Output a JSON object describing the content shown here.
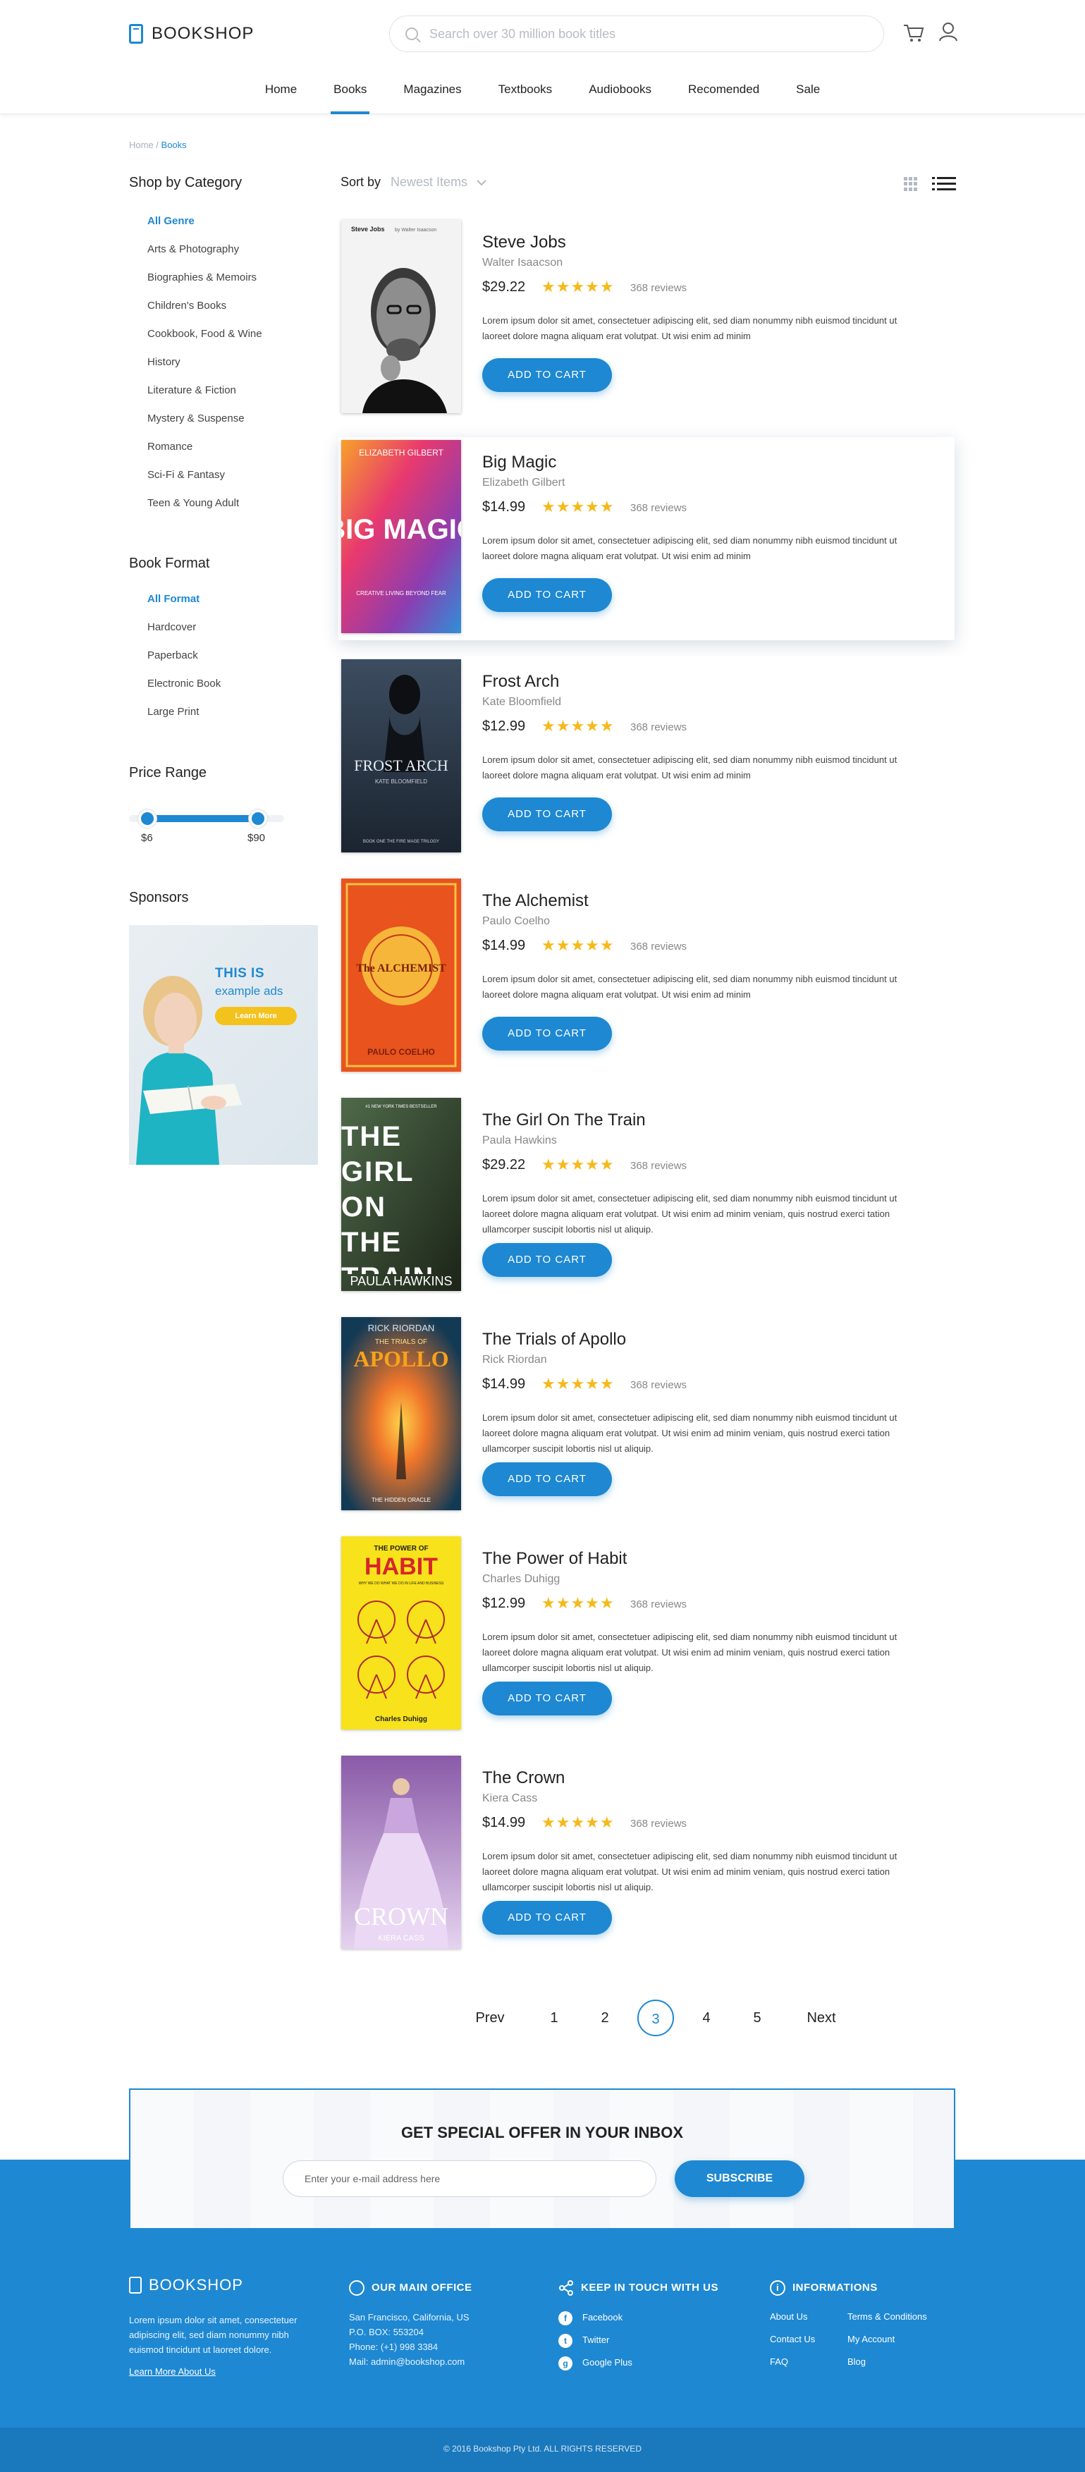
{
  "header": {
    "logo": "BOOKSHOP",
    "search_placeholder": "Search over 30 million book titles",
    "nav": [
      {
        "label": "Home",
        "active": false
      },
      {
        "label": "Books",
        "active": true
      },
      {
        "label": "Magazines",
        "active": false
      },
      {
        "label": "Textbooks",
        "active": false
      },
      {
        "label": "Audiobooks",
        "active": false
      },
      {
        "label": "Recomended",
        "active": false
      },
      {
        "label": "Sale",
        "active": false
      }
    ]
  },
  "breadcrumb": {
    "home": "Home",
    "sep": " / ",
    "current": "Books"
  },
  "sidebar": {
    "category_title": "Shop by Category",
    "categories": [
      "All Genre",
      "Arts & Photography",
      "Biographies & Memoirs",
      "Children's Books",
      "Cookbook, Food & Wine",
      "History",
      "Literature & Fiction",
      "Mystery & Suspense",
      "Romance",
      "Sci-Fi & Fantasy",
      "Teen & Young Adult"
    ],
    "format_title": "Book Format",
    "formats": [
      "All Format",
      "Hardcover",
      "Paperback",
      "Electronic Book",
      "Large Print"
    ],
    "price_title": "Price Range",
    "price_min": "$6",
    "price_max": "$90",
    "price_low_fraction": 0.12,
    "price_high_fraction": 0.83,
    "sponsors_title": "Sponsors",
    "ad": {
      "line1": "THIS IS",
      "line2": "example ads",
      "button": "Learn More"
    }
  },
  "sort": {
    "label": "Sort by",
    "value": "Newest Items"
  },
  "books": [
    {
      "title": "Steve Jobs",
      "author": "Walter Isaacson",
      "price": "$29.22",
      "reviews": "368 reviews",
      "rating": 5,
      "desc": "Lorem ipsum dolor sit amet, consectetuer adipiscing elit, sed diam nonummy nibh euismod tincidunt ut laoreet dolore magna aliquam erat volutpat. Ut wisi enim ad minim",
      "button": "ADD TO CART",
      "highlighted": false,
      "cover_top": "Steve Jobs",
      "cover_by": "by Walter Isaacson",
      "cover_bg": "#f3f3f3"
    },
    {
      "title": "Big Magic",
      "author": "Elizabeth Gilbert",
      "price": "$14.99",
      "reviews": "368 reviews",
      "rating": 5,
      "desc": "Lorem ipsum dolor sit amet, consectetuer adipiscing elit, sed diam nonummy nibh euismod tincidunt ut laoreet dolore magna aliquam erat volutpat. Ut wisi enim ad minim",
      "button": "ADD TO CART",
      "highlighted": true,
      "cover_top": "ELIZABETH GILBERT",
      "cover_big": "BIG MAGIC",
      "cover_sub": "CREATIVE LIVING BEYOND FEAR",
      "cover_bg": "#e03a7a"
    },
    {
      "title": "Frost Arch",
      "author": "Kate Bloomfield",
      "price": "$12.99",
      "reviews": "368 reviews",
      "rating": 5,
      "desc": "Lorem ipsum dolor sit amet, consectetuer adipiscing elit, sed diam nonummy nibh euismod tincidunt ut laoreet dolore magna aliquam erat volutpat. Ut wisi enim ad minim",
      "button": "ADD TO CART",
      "highlighted": false,
      "cover_big": "FROST ARCH",
      "cover_by": "KATE BLOOMFIELD",
      "cover_sub": "BOOK ONE THE FIRE MAGE TRILOGY",
      "cover_bg": "#2c3a4a"
    },
    {
      "title": "The Alchemist",
      "author": "Paulo Coelho",
      "price": "$14.99",
      "reviews": "368 reviews",
      "rating": 5,
      "desc": "Lorem ipsum dolor sit amet, consectetuer adipiscing elit, sed diam nonummy nibh euismod tincidunt ut laoreet dolore magna aliquam erat volutpat. Ut wisi enim ad minim",
      "button": "ADD TO CART",
      "highlighted": false,
      "cover_big": "The ALCHEMIST",
      "cover_by": "PAULO COELHO",
      "cover_bg": "#e8531e"
    },
    {
      "title": "The Girl On The Train",
      "author": "Paula Hawkins",
      "price": "$29.22",
      "reviews": "368 reviews",
      "rating": 5,
      "desc": "Lorem ipsum dolor sit amet, consectetuer adipiscing elit, sed diam nonummy nibh euismod tincidunt ut laoreet dolore magna aliquam erat volutpat. Ut wisi enim ad minim veniam, quis nostrud exerci tation ullamcorper suscipit lobortis nisl ut aliquip.",
      "button": "ADD TO CART",
      "highlighted": false,
      "cover_top": "#1 NEW YORK TIMES BESTSELLER",
      "cover_big": "THE GIRL ON THE TRAIN",
      "cover_by": "PAULA HAWKINS",
      "cover_bg": "#2f3b2a"
    },
    {
      "title": "The Trials of Apollo",
      "author": "Rick Riordan",
      "price": "$14.99",
      "reviews": "368 reviews",
      "rating": 5,
      "desc": "Lorem ipsum dolor sit amet, consectetuer adipiscing elit, sed diam nonummy nibh euismod tincidunt ut laoreet dolore magna aliquam erat volutpat. Ut wisi enim ad minim veniam, quis nostrud exerci tation ullamcorper suscipit lobortis nisl ut aliquip.",
      "button": "ADD TO CART",
      "highlighted": false,
      "cover_top": "RICK RIORDAN",
      "cover_sub": "THE TRIALS OF",
      "cover_big": "APOLLO",
      "cover_by": "THE HIDDEN ORACLE",
      "cover_bg": "#1d4f6e"
    },
    {
      "title": "The Power of Habit",
      "author": "Charles Duhigg",
      "price": "$12.99",
      "reviews": "368 reviews",
      "rating": 5,
      "desc": "Lorem ipsum dolor sit amet, consectetuer adipiscing elit, sed diam nonummy nibh euismod tincidunt ut laoreet dolore magna aliquam erat volutpat. Ut wisi enim ad minim veniam, quis nostrud exerci tation ullamcorper suscipit lobortis nisl ut aliquip.",
      "button": "ADD TO CART",
      "highlighted": false,
      "cover_top": "THE POWER OF",
      "cover_big": "HABIT",
      "cover_sub": "WHY WE DO WHAT WE DO IN LIFE AND BUSINESS",
      "cover_by": "Charles Duhigg",
      "cover_bg": "#f7e21b"
    },
    {
      "title": "The Crown",
      "author": "Kiera Cass",
      "price": "$14.99",
      "reviews": "368 reviews",
      "rating": 5,
      "desc": "Lorem ipsum dolor sit amet, consectetuer adipiscing elit, sed diam nonummy nibh euismod tincidunt ut laoreet dolore magna aliquam erat volutpat. Ut wisi enim ad minim veniam, quis nostrud exerci tation ullamcorper suscipit lobortis nisl ut aliquip.",
      "button": "ADD TO CART",
      "highlighted": false,
      "cover_big": "CROWN",
      "cover_by": "KIERA CASS",
      "cover_bg": "#6c4f8a"
    }
  ],
  "pagination": {
    "prev": "Prev",
    "pages": [
      "1",
      "2",
      "3",
      "4",
      "5"
    ],
    "current": "3",
    "next": "Next"
  },
  "newsletter": {
    "title": "GET SPECIAL OFFER IN YOUR INBOX",
    "placeholder": "Enter your e-mail address here",
    "button": "SUBSCRIBE"
  },
  "footer": {
    "logo": "BOOKSHOP",
    "about": "Lorem ipsum dolor sit amet, consectetuer adipiscing elit, sed diam nonummy nibh euismod tincidunt ut laoreet dolore.",
    "learn_more": "Learn More About Us",
    "office_title": "OUR MAIN OFFICE",
    "office_lines": [
      "San Francisco, California, US",
      "P.O. BOX: 553204",
      "Phone: (+1) 998 3384",
      "Mail: admin@bookshop.com"
    ],
    "social_title": "KEEP IN TOUCH WITH US",
    "social": [
      "Facebook",
      "Twitter",
      "Google Plus"
    ],
    "info_title": "INFORMATIONS",
    "info_col1": [
      "About Us",
      "Contact Us",
      "FAQ"
    ],
    "info_col2": [
      "Terms & Conditions",
      "My Account",
      "Blog"
    ],
    "copyright": "© 2016 Bookshop Pty Ltd. ALL RIGHTS RESERVED"
  },
  "colors": {
    "accent": "#1e88d2",
    "star": "#f6b91a",
    "ad_button": "#f4c21d"
  }
}
